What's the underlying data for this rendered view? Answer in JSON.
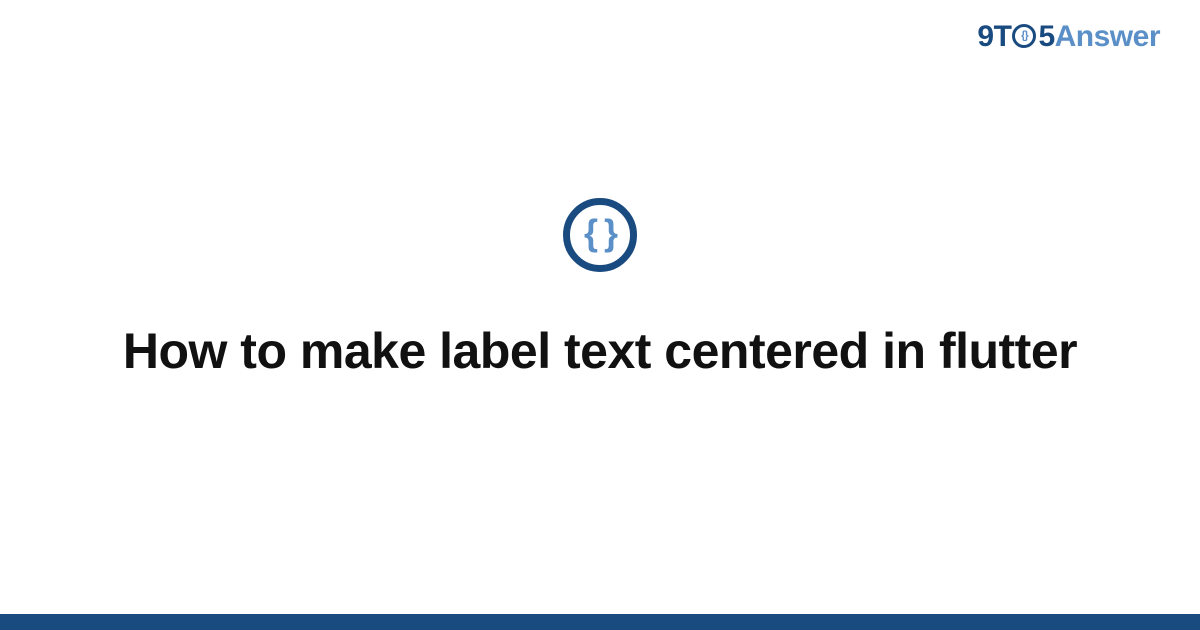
{
  "brand": {
    "prefix": "9T",
    "five": "5",
    "suffix": "Answer"
  },
  "logo": {
    "glyph": "{ }"
  },
  "title": "How to make label text centered in flutter",
  "colors": {
    "dark": "#1a4b80",
    "light": "#5a8fc7"
  }
}
